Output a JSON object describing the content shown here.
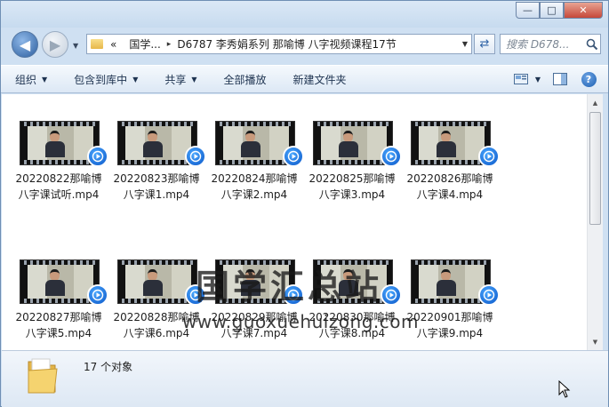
{
  "window": {
    "buttons": {
      "minimize": "—",
      "maximize": "□",
      "close": "✕"
    }
  },
  "address_bar": {
    "lead": "«",
    "crumbs": [
      "国学...",
      "D6787 李秀娟系列 那喻博 八字视频课程17节"
    ],
    "separator": "▸"
  },
  "search": {
    "placeholder": "搜索 D678..."
  },
  "toolbar": {
    "organize": "组织",
    "include_in_library": "包含到库中",
    "share": "共享",
    "play_all": "全部播放",
    "new_folder": "新建文件夹"
  },
  "files": [
    {
      "line1": "20220822那喻博",
      "line2": "八字课试听.mp4"
    },
    {
      "line1": "20220823那喻博",
      "line2": "八字课1.mp4"
    },
    {
      "line1": "20220824那喻博",
      "line2": "八字课2.mp4"
    },
    {
      "line1": "20220825那喻博",
      "line2": "八字课3.mp4"
    },
    {
      "line1": "20220826那喻博",
      "line2": "八字课4.mp4"
    },
    {
      "line1": "20220827那喻博",
      "line2": "八字课5.mp4"
    },
    {
      "line1": "20220828那喻博",
      "line2": "八字课6.mp4"
    },
    {
      "line1": "20220829那喻博",
      "line2": "八字课7.mp4"
    },
    {
      "line1": "20220830那喻博",
      "line2": "八字课8.mp4"
    },
    {
      "line1": "20220901那喻博",
      "line2": "八字课9.mp4"
    }
  ],
  "watermark": {
    "title": "国学汇总站",
    "url": "www.guoxuehuizong.com"
  },
  "status": {
    "count": "17 个对象"
  },
  "colors": {
    "accent": "#2d5f9f",
    "toolbar_text": "#1e3350",
    "play_badge": "#0a56c8"
  }
}
